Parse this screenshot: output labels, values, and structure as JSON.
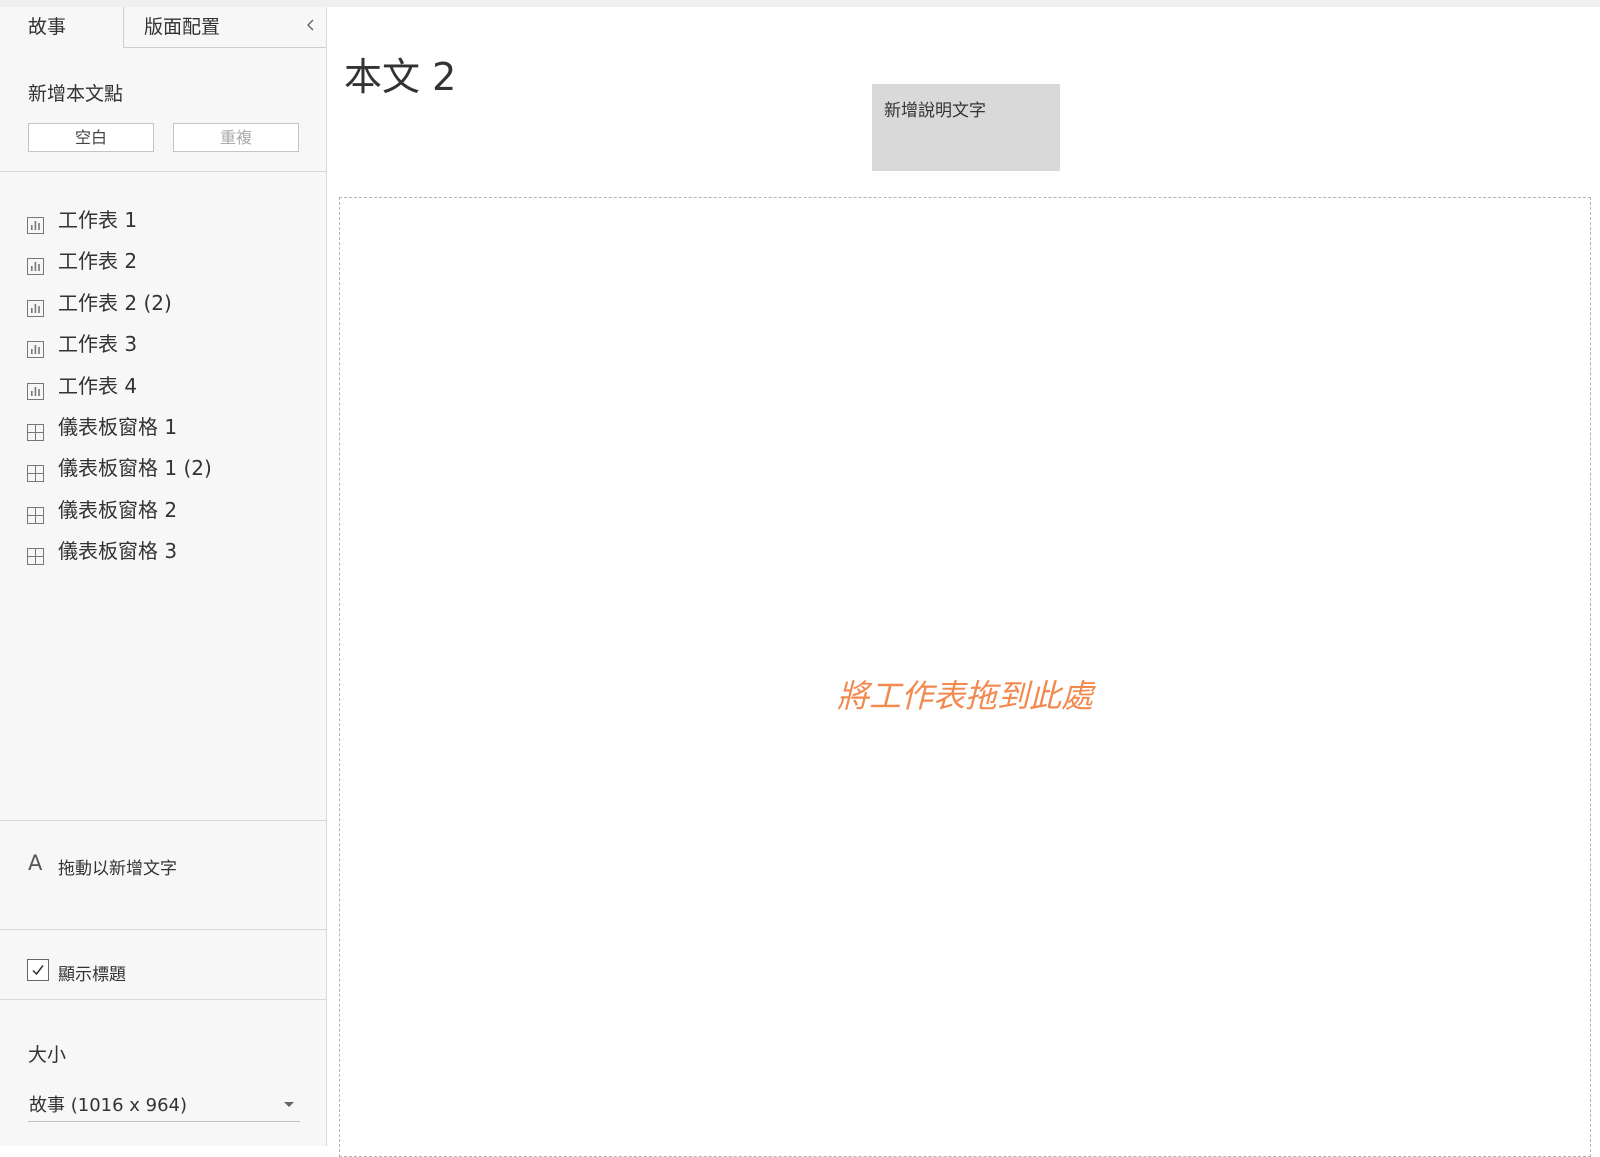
{
  "sidebar": {
    "tabs": [
      {
        "label": "故事",
        "active": true
      },
      {
        "label": "版面配置",
        "active": false
      }
    ],
    "new_story_point": {
      "label": "新增本文點",
      "blank_button": "空白",
      "duplicate_button": "重複"
    },
    "sheets": [
      {
        "label": "工作表 1",
        "icon": "worksheet-icon"
      },
      {
        "label": "工作表 2",
        "icon": "worksheet-icon"
      },
      {
        "label": "工作表 2 (2)",
        "icon": "worksheet-icon"
      },
      {
        "label": "工作表 3",
        "icon": "worksheet-icon"
      },
      {
        "label": "工作表 4",
        "icon": "worksheet-icon"
      },
      {
        "label": "儀表板窗格 1",
        "icon": "dashboard-icon"
      },
      {
        "label": "儀表板窗格 1 (2)",
        "icon": "dashboard-icon"
      },
      {
        "label": "儀表板窗格 2",
        "icon": "dashboard-icon"
      },
      {
        "label": "儀表板窗格 3",
        "icon": "dashboard-icon"
      }
    ],
    "text_tool": {
      "icon_glyph": "A",
      "label": "拖動以新增文字"
    },
    "show_title": {
      "label": "顯示標題",
      "checked": true
    },
    "size": {
      "label": "大小",
      "value": "故事 (1016 x 964)"
    }
  },
  "main": {
    "title": "本文 2",
    "caption_placeholder": "新增說明文字",
    "drop_hint": "將工作表拖到此處"
  },
  "colors": {
    "drop_hint": "#f28a4f",
    "sidebar_bg": "#f7f7f7",
    "caption_bg": "#d9d9d9"
  }
}
